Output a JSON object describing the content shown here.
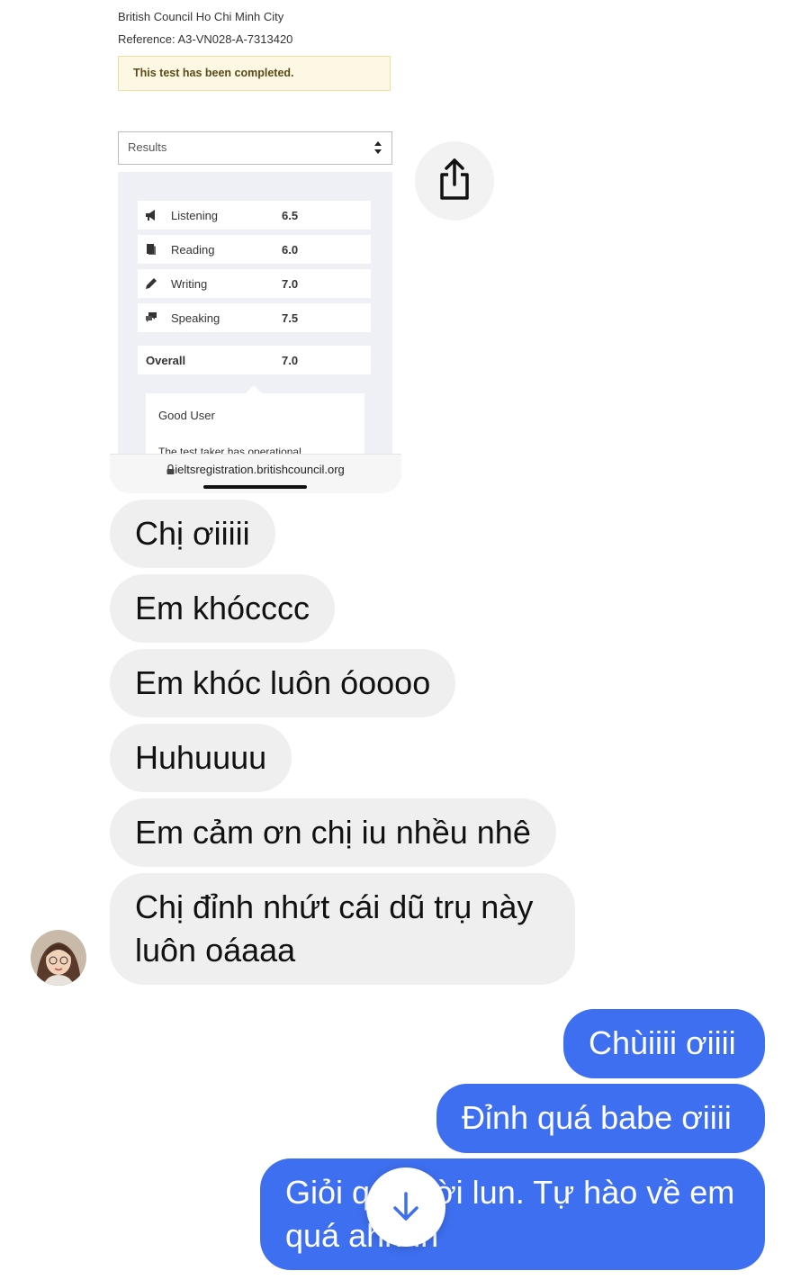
{
  "shared_image": {
    "centre_name": "British Council Ho Chi Minh City",
    "reference": "Reference: A3-VN028-A-7313420",
    "notice": "This test has been completed.",
    "dropdown_label": "Results",
    "scores": [
      {
        "skill": "Listening",
        "score": "6.5",
        "icon": "megaphone-icon"
      },
      {
        "skill": "Reading",
        "score": "6.0",
        "icon": "book-icon"
      },
      {
        "skill": "Writing",
        "score": "7.0",
        "icon": "pencil-icon"
      },
      {
        "skill": "Speaking",
        "score": "7.5",
        "icon": "speech-bubbles-icon"
      }
    ],
    "overall": {
      "label": "Overall",
      "score": "7.0"
    },
    "band_descriptor": "Good User",
    "band_description_partial": "The test taker has operational",
    "url": "ieltsregistration.britishcouncil.org"
  },
  "messages_received": [
    "Chị ơiiiii",
    "Em khócccc",
    "Em khóc luôn óoooo",
    "Huhuuuu",
    "Em cảm ơn chị iu nhều nhê",
    "Chị đỉnh nhứt cái dũ trụ này luôn oáaaa"
  ],
  "messages_sent": [
    "Chùiiii ơiiii",
    "Đỉnh quá babe ơiiii",
    "Giỏi quá trời lun. Tự hào về em quá ahhhh"
  ],
  "colors": {
    "sent_bubble": "#3e6ff0",
    "received_bubble": "#efefef",
    "notice_bg": "#fcf8e3"
  }
}
